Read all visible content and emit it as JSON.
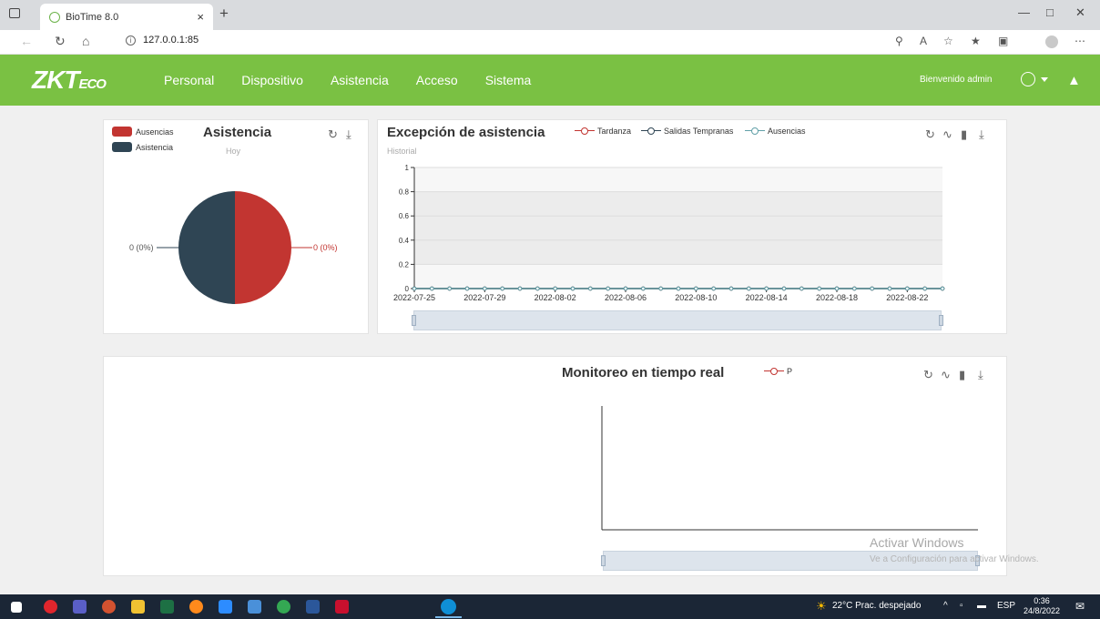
{
  "browser": {
    "tab_title": "BioTime 8.0",
    "tab_close": "×",
    "new_tab": "+",
    "url": "127.0.0.1:85"
  },
  "app": {
    "logo_main": "ZKT",
    "logo_suffix": "ECO",
    "menu": [
      "Personal",
      "Dispositivo",
      "Asistencia",
      "Acceso",
      "Sistema"
    ],
    "welcome": "Bienvenido admin"
  },
  "attendance_panel": {
    "title": "Asistencia",
    "subtitle": "Hoy",
    "legend": [
      {
        "label": "Ausencias",
        "color": "#c23531"
      },
      {
        "label": "Asistencia",
        "color": "#2f4554"
      }
    ],
    "label_left": "0 (0%)",
    "label_right": "0 (0%)"
  },
  "exception_panel": {
    "title": "Excepción de asistencia",
    "subtitle": "Historial",
    "legend": [
      {
        "label": "Tardanza",
        "color": "#c23531"
      },
      {
        "label": "Salidas Tempranas",
        "color": "#2f4554"
      },
      {
        "label": "Ausencias",
        "color": "#61a0a8"
      }
    ]
  },
  "monitor_panel": {
    "title": "Monitoreo en tiempo real",
    "legend": [
      {
        "label": "P",
        "color": "#c23531"
      }
    ]
  },
  "chart_data": [
    {
      "type": "pie",
      "title": "Asistencia",
      "subtitle": "Hoy",
      "slices": [
        {
          "name": "Ausencias",
          "value": 0,
          "label": "0 (0%)",
          "color": "#c23531"
        },
        {
          "name": "Asistencia",
          "value": 0,
          "label": "0 (0%)",
          "color": "#2f4554"
        }
      ]
    },
    {
      "type": "line",
      "title": "Excepción de asistencia",
      "subtitle": "Historial",
      "x_tick_labels": [
        "2022-07-25",
        "2022-07-29",
        "2022-08-02",
        "2022-08-06",
        "2022-08-10",
        "2022-08-14",
        "2022-08-18",
        "2022-08-22"
      ],
      "y_tick_labels": [
        "0",
        "0.2",
        "0.4",
        "0.6",
        "0.8",
        "1"
      ],
      "ylim": [
        0,
        1
      ],
      "x_range": [
        "2022-07-25",
        "2022-08-24"
      ],
      "series": [
        {
          "name": "Tardanza",
          "values": [
            0
          ],
          "color": "#c23531"
        },
        {
          "name": "Salidas Tempranas",
          "values": [
            0
          ],
          "color": "#2f4554"
        },
        {
          "name": "Ausencias",
          "values": [
            0
          ],
          "color": "#61a0a8"
        }
      ],
      "grid": true
    },
    {
      "type": "line",
      "title": "Monitoreo en tiempo real",
      "series": [
        {
          "name": "P",
          "values": [],
          "color": "#c23531"
        }
      ]
    }
  ],
  "watermark": {
    "line1": "Activar Windows",
    "line2": "Ve a Configuración para activar Windows."
  },
  "taskbar": {
    "weather": "22°C  Prac. despejado",
    "lang": "ESP",
    "time": "0:36",
    "date": "24/8/2022"
  }
}
